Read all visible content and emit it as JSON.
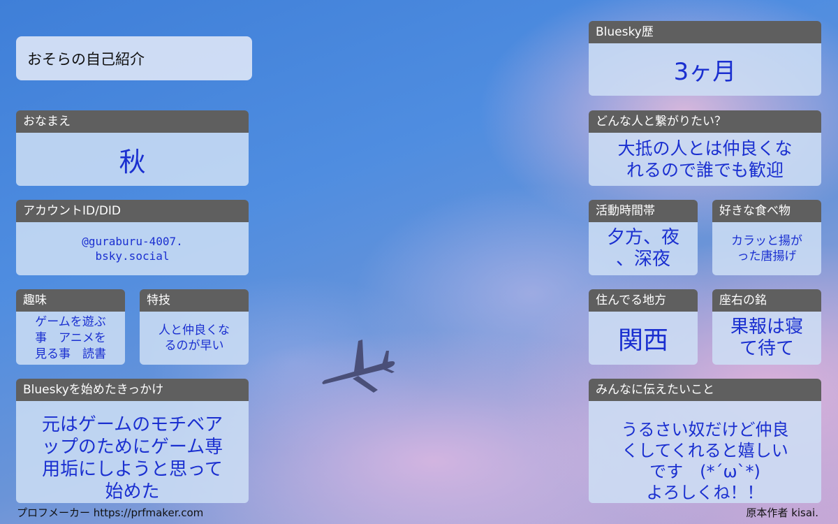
{
  "profile_title": "おそらの自己紹介",
  "fields": {
    "name": {
      "label": "おなまえ",
      "value": "秋"
    },
    "account_id": {
      "label": "アカウントID/DID",
      "value": "@guraburu-4007.\nbsky.social"
    },
    "hobby": {
      "label": "趣味",
      "value": "ゲームを遊ぶ\n事　アニメを\n見る事　読書"
    },
    "skill": {
      "label": "特技",
      "value": "人と仲良くな\nるのが早い"
    },
    "reason": {
      "label": "Blueskyを始めたきっかけ",
      "value": "元はゲームのモチベア\nップのためにゲーム専\n用垢にしようと思って\n始めた"
    },
    "bluesky_history": {
      "label": "Bluesky歴",
      "value": "3ヶ月"
    },
    "connect_with": {
      "label": "どんな人と繋がりたい？",
      "value": "大抵の人とは仲良くな\nれるので誰でも歓迎"
    },
    "active_time": {
      "label": "活動時間帯",
      "value": "夕方、夜\n、深夜"
    },
    "favorite_food": {
      "label": "好きな食べ物",
      "value": "カラッと揚が\nった唐揚げ"
    },
    "region": {
      "label": "住んでる地方",
      "value": "関西"
    },
    "motto": {
      "label": "座右の銘",
      "value": "果報は寝\nて待て"
    },
    "message": {
      "label": "みんなに伝えたいこと",
      "value": "うるさい奴だけど仲良\nくしてくれると嬉しい\nです　(*´ω`*)\nよろしくね！！"
    }
  },
  "footer": {
    "left": "プロフメーカー https://prfmaker.com",
    "right": "原本作者 kisai."
  },
  "colors": {
    "header_bg": "#5f5f5f",
    "value_text": "#1a2fd0",
    "card_bg": "#cddef5"
  },
  "icons": {
    "airplane": "airplane-icon"
  }
}
